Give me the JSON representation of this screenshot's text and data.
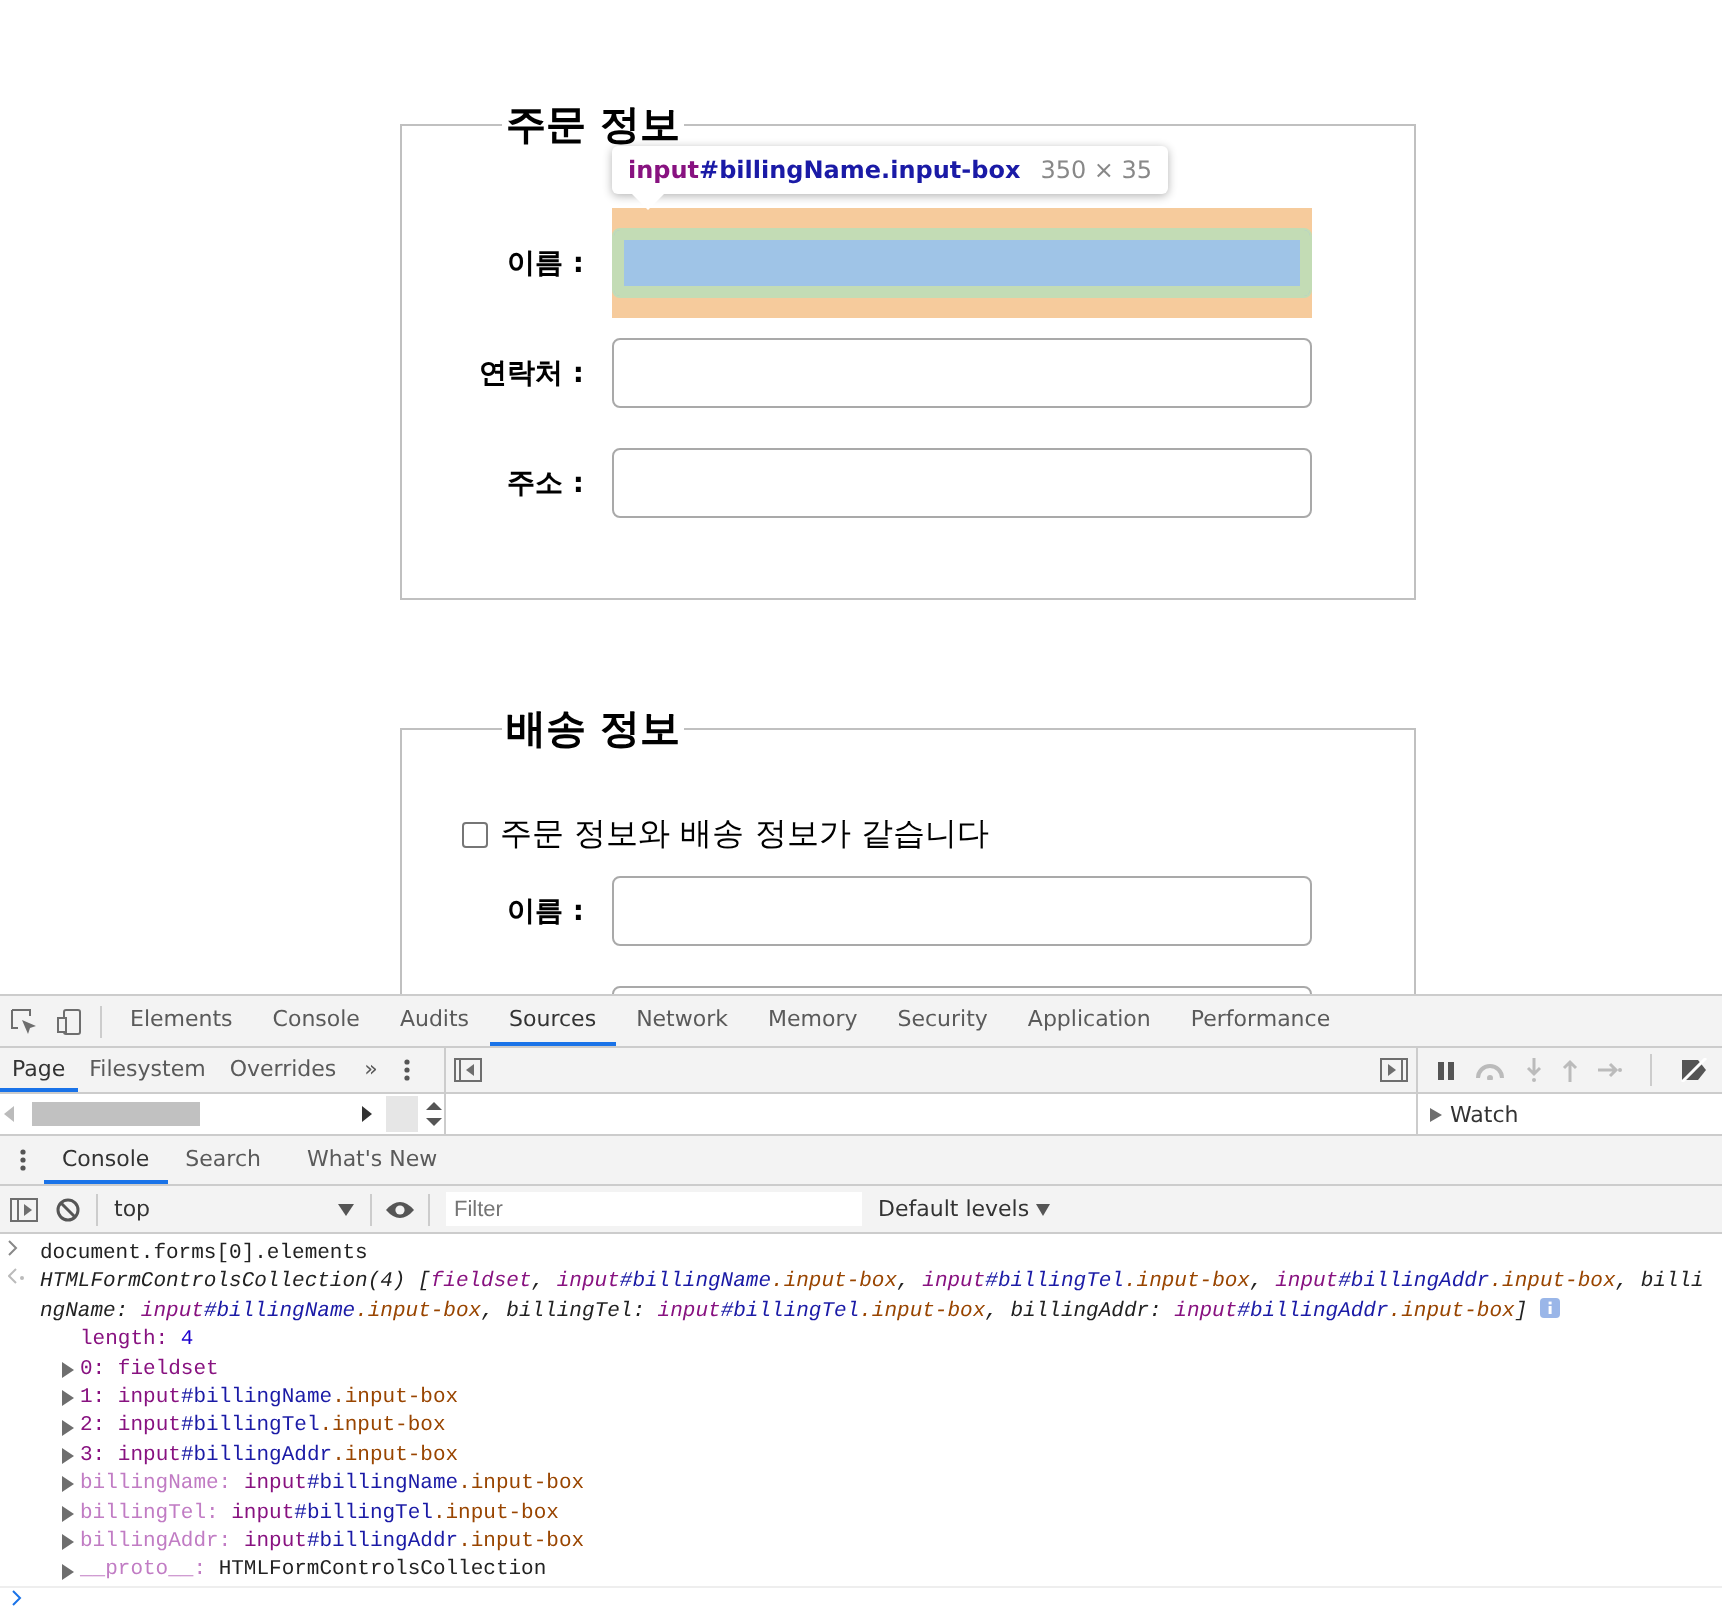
{
  "sections": [
    {
      "legend": "주문 정보",
      "fields": [
        {
          "label": "이름 :",
          "highlighted": true
        },
        {
          "label": "연락처 :",
          "highlighted": false
        },
        {
          "label": "주소 :",
          "highlighted": false
        }
      ]
    },
    {
      "legend": "배송 정보",
      "same_checkbox": {
        "label": "주문 정보와 배송 정보가 같습니다",
        "checked": false
      },
      "fields": [
        {
          "label": "이름 :",
          "highlighted": false
        },
        {
          "highlighted": false
        }
      ]
    }
  ],
  "inspect_tooltip": {
    "tag": "input",
    "selector": "#billingName.input-box",
    "size": "350 × 35"
  },
  "devtools": {
    "tabs": [
      {
        "label": "Elements",
        "selected": false
      },
      {
        "label": "Console",
        "selected": false
      },
      {
        "label": "Audits",
        "selected": false
      },
      {
        "label": "Sources",
        "selected": true
      },
      {
        "label": "Network",
        "selected": false
      },
      {
        "label": "Memory",
        "selected": false
      },
      {
        "label": "Security",
        "selected": false
      },
      {
        "label": "Application",
        "selected": false
      },
      {
        "label": "Performance",
        "selected": false
      }
    ],
    "navigator_tabs": [
      {
        "label": "Page",
        "selected": true
      },
      {
        "label": "Filesystem",
        "selected": false
      },
      {
        "label": "Overrides",
        "selected": false
      }
    ],
    "more_tabs": "»",
    "watch": {
      "label": "Watch",
      "expanded": false
    },
    "drawer_tabs": [
      {
        "label": "Console",
        "selected": true
      },
      {
        "label": "Search",
        "selected": false
      },
      {
        "label": "What's New",
        "selected": false
      }
    ],
    "context": "top",
    "filter_placeholder": "Filter",
    "levels": "Default levels",
    "command": "document.forms[0].elements",
    "summary": [
      {
        "text": "HTMLFormControlsCollection(4) [",
        "kind": "plain"
      },
      {
        "text": "fieldset",
        "kind": "tag"
      },
      {
        "text": ", ",
        "kind": "plain"
      },
      {
        "text": "input",
        "kind": "tag"
      },
      {
        "text": "#billingName",
        "kind": "id"
      },
      {
        "text": ".input-box",
        "kind": "class"
      },
      {
        "text": ", ",
        "kind": "plain"
      },
      {
        "text": "input",
        "kind": "tag"
      },
      {
        "text": "#billingTel",
        "kind": "id"
      },
      {
        "text": ".input-box",
        "kind": "class"
      },
      {
        "text": ", ",
        "kind": "plain"
      },
      {
        "text": "input",
        "kind": "tag"
      },
      {
        "text": "#billingAddr",
        "kind": "id"
      },
      {
        "text": ".input-box",
        "kind": "class"
      },
      {
        "text": ", billingName: ",
        "kind": "plain"
      },
      {
        "text": "input",
        "kind": "tag"
      },
      {
        "text": "#billingName",
        "kind": "id"
      },
      {
        "text": ".input-box",
        "kind": "class"
      },
      {
        "text": ", billingTel: ",
        "kind": "plain"
      },
      {
        "text": "input",
        "kind": "tag"
      },
      {
        "text": "#billingTel",
        "kind": "id"
      },
      {
        "text": ".input-box",
        "kind": "class"
      },
      {
        "text": ", billingAddr: ",
        "kind": "plain"
      },
      {
        "text": "input",
        "kind": "tag"
      },
      {
        "text": "#billingAddr",
        "kind": "id"
      },
      {
        "text": ".input-box",
        "kind": "class"
      },
      {
        "text": "]",
        "kind": "plain"
      }
    ],
    "properties": [
      {
        "key": "length:",
        "kind": "index",
        "expandable": false,
        "value": [
          {
            "text": "4",
            "kind": "number"
          }
        ]
      },
      {
        "key": "0:",
        "kind": "index",
        "expandable": true,
        "value": [
          {
            "text": "fieldset",
            "kind": "tag"
          }
        ]
      },
      {
        "key": "1:",
        "kind": "index",
        "expandable": true,
        "value": [
          {
            "text": "input",
            "kind": "tag"
          },
          {
            "text": "#billingName",
            "kind": "id"
          },
          {
            "text": ".input-box",
            "kind": "class"
          }
        ]
      },
      {
        "key": "2:",
        "kind": "index",
        "expandable": true,
        "value": [
          {
            "text": "input",
            "kind": "tag"
          },
          {
            "text": "#billingTel",
            "kind": "id"
          },
          {
            "text": ".input-box",
            "kind": "class"
          }
        ]
      },
      {
        "key": "3:",
        "kind": "index",
        "expandable": true,
        "value": [
          {
            "text": "input",
            "kind": "tag"
          },
          {
            "text": "#billingAddr",
            "kind": "id"
          },
          {
            "text": ".input-box",
            "kind": "class"
          }
        ]
      },
      {
        "key": "billingName:",
        "kind": "named",
        "expandable": true,
        "value": [
          {
            "text": "input",
            "kind": "tag"
          },
          {
            "text": "#billingName",
            "kind": "id"
          },
          {
            "text": ".input-box",
            "kind": "class"
          }
        ]
      },
      {
        "key": "billingTel:",
        "kind": "named",
        "expandable": true,
        "value": [
          {
            "text": "input",
            "kind": "tag"
          },
          {
            "text": "#billingTel",
            "kind": "id"
          },
          {
            "text": ".input-box",
            "kind": "class"
          }
        ]
      },
      {
        "key": "billingAddr:",
        "kind": "named",
        "expandable": true,
        "value": [
          {
            "text": "input",
            "kind": "tag"
          },
          {
            "text": "#billingAddr",
            "kind": "id"
          },
          {
            "text": ".input-box",
            "kind": "class"
          }
        ]
      },
      {
        "key": "__proto__:",
        "kind": "named",
        "expandable": true,
        "value": [
          {
            "text": "HTMLFormControlsCollection",
            "kind": "plain"
          }
        ]
      }
    ]
  }
}
